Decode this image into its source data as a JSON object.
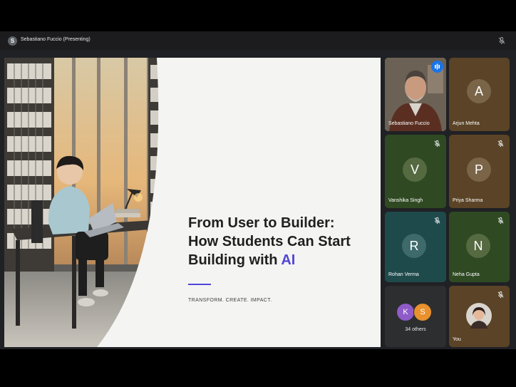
{
  "header": {
    "presenter_initial": "S",
    "presenter_label": "Sebastiano Fuccio (Presenting)"
  },
  "slide": {
    "title_line1": "From User to Builder:",
    "title_line2": "How Students Can Start",
    "title_line3_prefix": "Building with ",
    "title_line3_accent": "AI",
    "tagline": "TRANSFORM. CREATE. IMPACT.",
    "accent_color": "#5146d8"
  },
  "participants": [
    {
      "name": "Sebastiano Fuccio",
      "type": "video",
      "speaking": true
    },
    {
      "name": "Arjun Mehta",
      "initial": "A",
      "muted": true
    },
    {
      "name": "Vanshika Singh",
      "initial": "V",
      "muted": true
    },
    {
      "name": "Priya Sharma",
      "initial": "P",
      "muted": true
    },
    {
      "name": "Rohan Verma",
      "initial": "R",
      "muted": true
    },
    {
      "name": "Neha Gupta",
      "initial": "N",
      "muted": true
    },
    {
      "name": "You",
      "type": "photo",
      "muted": true
    }
  ],
  "others": {
    "initials": [
      "K",
      "S"
    ],
    "label": "34 others"
  },
  "colors": {
    "tile_brown": "#5a4326",
    "tile_green": "#2f4a22",
    "tile_teal": "#1f4a4c",
    "tile_dark": "#2d2e30",
    "speaking_blue": "#1a73e8"
  }
}
